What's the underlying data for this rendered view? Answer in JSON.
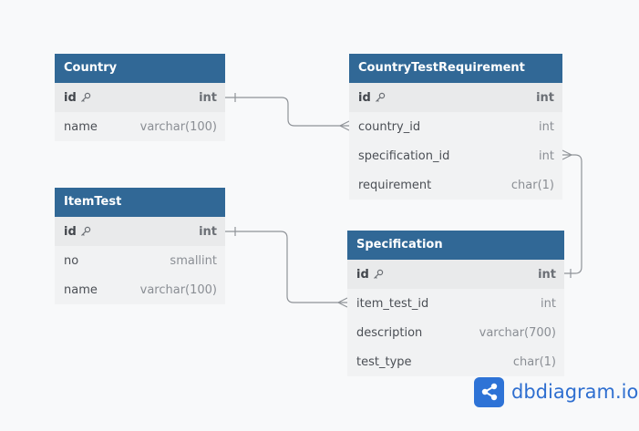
{
  "tables": {
    "country": {
      "name": "Country",
      "columns": [
        {
          "name": "id",
          "type": "int",
          "pk": true
        },
        {
          "name": "name",
          "type": "varchar(100)"
        }
      ]
    },
    "item_test": {
      "name": "ItemTest",
      "columns": [
        {
          "name": "id",
          "type": "int",
          "pk": true
        },
        {
          "name": "no",
          "type": "smallint"
        },
        {
          "name": "name",
          "type": "varchar(100)"
        }
      ]
    },
    "country_test_requirement": {
      "name": "CountryTestRequirement",
      "columns": [
        {
          "name": "id",
          "type": "int",
          "pk": true
        },
        {
          "name": "country_id",
          "type": "int"
        },
        {
          "name": "specification_id",
          "type": "int"
        },
        {
          "name": "requirement",
          "type": "char(1)"
        }
      ]
    },
    "specification": {
      "name": "Specification",
      "columns": [
        {
          "name": "id",
          "type": "int",
          "pk": true
        },
        {
          "name": "item_test_id",
          "type": "int"
        },
        {
          "name": "description",
          "type": "varchar(700)"
        },
        {
          "name": "test_type",
          "type": "char(1)"
        }
      ]
    }
  },
  "logo": {
    "text": "dbdiagram.io",
    "icon": "share-nodes-icon"
  },
  "colors": {
    "header": "#316896",
    "connector": "#8f9398",
    "logo": "#2e73d6"
  }
}
